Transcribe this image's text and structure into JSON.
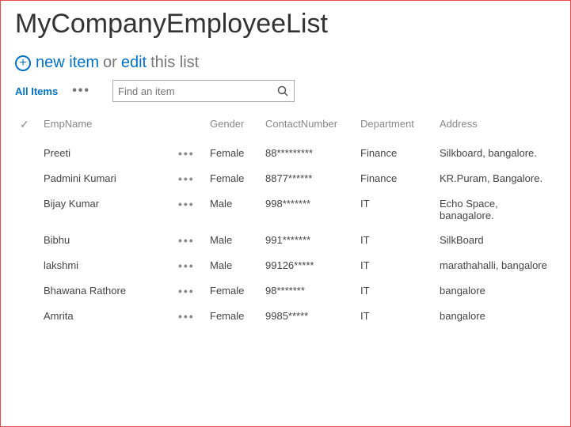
{
  "page": {
    "title": "MyCompanyEmployeeList"
  },
  "toolbar": {
    "new_item_label": "new item",
    "or_label": "or",
    "edit_label": "edit",
    "this_list_label": "this list"
  },
  "views": {
    "all_items_label": "All Items",
    "more_icon": "•••"
  },
  "search": {
    "placeholder": "Find an item"
  },
  "columns": {
    "emp_name": "EmpName",
    "gender": "Gender",
    "contact": "ContactNumber",
    "department": "Department",
    "address": "Address"
  },
  "rows": [
    {
      "emp_name": "Preeti",
      "gender": "Female",
      "contact": "88*********",
      "department": "Finance",
      "address": "Silkboard, bangalore."
    },
    {
      "emp_name": "Padmini Kumari",
      "gender": "Female",
      "contact": "8877******",
      "department": "Finance",
      "address": "KR.Puram, Bangalore."
    },
    {
      "emp_name": "Bijay Kumar",
      "gender": "Male",
      "contact": "998*******",
      "department": "IT",
      "address": "Echo Space, banagalore."
    },
    {
      "emp_name": "Bibhu",
      "gender": "Male",
      "contact": "991*******",
      "department": "IT",
      "address": "SilkBoard"
    },
    {
      "emp_name": "lakshmi",
      "gender": "Male",
      "contact": "99126*****",
      "department": "IT",
      "address": "marathahalli, bangalore"
    },
    {
      "emp_name": "Bhawana Rathore",
      "gender": "Female",
      "contact": "98*******",
      "department": "IT",
      "address": "bangalore"
    },
    {
      "emp_name": "Amrita",
      "gender": "Female",
      "contact": "9985*****",
      "department": "IT",
      "address": "bangalore"
    }
  ],
  "icons": {
    "row_menu": "•••",
    "check": "✓",
    "plus": "+"
  }
}
